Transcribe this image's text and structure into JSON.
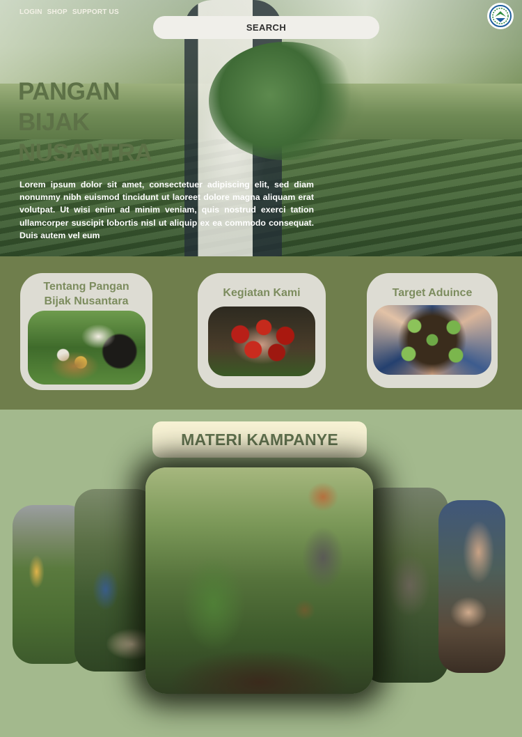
{
  "nav": {
    "login": "LOGIN",
    "shop": "SHOP",
    "support": "SUPPORT US"
  },
  "search": {
    "label": "SEARCH"
  },
  "logo": {
    "icon": "ministry-emblem-icon",
    "colors": [
      "#1f5f9e",
      "#2e8b3e"
    ]
  },
  "hero": {
    "title_lines": [
      "PANGAN",
      "BIJAK",
      "NUSANTRA"
    ],
    "body": "Lorem ipsum dolor sit amet, consectetuer adipiscing elit, sed diam nonummy nibh euismod tincidunt ut laoreet dolore magna aliquam erat volutpat. Ut wisi enim ad minim veniam, quis nostrud exerci tation ullamcorper suscipit lobortis nisl ut aliquip ex ea commodo consequat. Duis autem vel eum"
  },
  "cards": [
    {
      "label_lines": [
        "Tentang Pangan",
        "Bijak Nusantara"
      ],
      "image": "harvest-basket-photo"
    },
    {
      "label_lines": [
        "Kegiatan Kami"
      ],
      "image": "tomatoes-in-hands-photo"
    },
    {
      "label_lines": [
        "Target Aduince"
      ],
      "image": "seedlings-circle-photo"
    }
  ],
  "materi": {
    "title": "MATERI KAMPANYE"
  },
  "carousel": [
    "garden-walk-photo",
    "planting-photo",
    "community-gardening-photo",
    "garden-work-photo",
    "seedling-hands-photo"
  ],
  "colors": {
    "title": "#5d7147",
    "band": "#6f7e4c",
    "page": "#a3b98d",
    "materi_bg": "#f7f2d4"
  }
}
